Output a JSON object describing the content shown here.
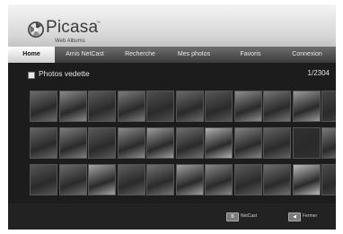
{
  "app": {
    "name": "Picasa",
    "trademark": "™",
    "subtitle": "Web Albums"
  },
  "nav": {
    "tabs": [
      {
        "label": "Home",
        "active": true
      },
      {
        "label": "Amis NetCast",
        "active": false
      },
      {
        "label": "Recherche",
        "active": false
      },
      {
        "label": "Mes photos",
        "active": false
      },
      {
        "label": "Favoris",
        "active": false
      },
      {
        "label": "Connexion",
        "active": false
      }
    ]
  },
  "section": {
    "title": "Photos vedette",
    "counter": "1/2304"
  },
  "grid": {
    "rows": 3,
    "columns": 11,
    "thumbnails": [
      {
        "tone": "#6d6d6d"
      },
      {
        "tone": "#8a8a8a"
      },
      {
        "tone": "#5b5b5b"
      },
      {
        "tone": "#7c7c7c"
      },
      {
        "tone": "#4f4f4f"
      },
      {
        "tone": "#6a6a6a"
      },
      {
        "tone": "#575757"
      },
      {
        "tone": "#8f8f8f"
      },
      {
        "tone": "#747474"
      },
      {
        "tone": "#9a9a9a"
      },
      {
        "tone": "#444444"
      },
      {
        "tone": "#666666"
      },
      {
        "tone": "#7e7e7e"
      },
      {
        "tone": "#595959"
      },
      {
        "tone": "#8c8c8c"
      },
      {
        "tone": "#9c9c9c"
      },
      {
        "tone": "#6f6f6f"
      },
      {
        "tone": "#b0b0b0"
      },
      {
        "tone": "#838383"
      },
      {
        "tone": "#626262"
      },
      {
        "tone": "#303030"
      },
      {
        "tone": "#7a7a7a"
      },
      {
        "tone": "#555555"
      },
      {
        "tone": "#6b6b6b"
      },
      {
        "tone": "#a5a5a5"
      },
      {
        "tone": "#5e5e5e"
      },
      {
        "tone": "#727272"
      },
      {
        "tone": "#9f9f9f"
      },
      {
        "tone": "#888888"
      },
      {
        "tone": "#5a5a5a"
      },
      {
        "tone": "#6e6e6e"
      },
      {
        "tone": "#bdbdbd"
      },
      {
        "tone": "#4a4a4a"
      }
    ]
  },
  "footer": {
    "hints": [
      {
        "key": "B",
        "label": "NetCast"
      },
      {
        "key": "◀",
        "label": "Fermer"
      }
    ]
  },
  "colors": {
    "background": "#1c1c1c",
    "header": "#d9d9d9",
    "nav_active": "#ffffff",
    "text_light": "#e6e6e6"
  }
}
